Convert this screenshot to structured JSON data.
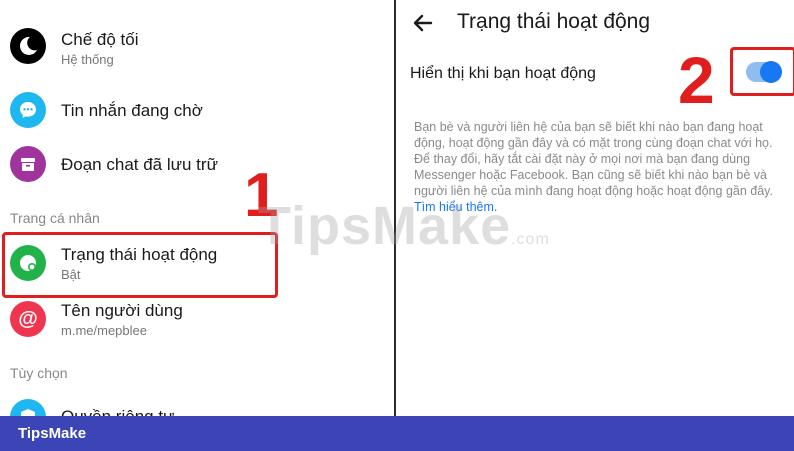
{
  "left": {
    "items": [
      {
        "title": "Chế độ tối",
        "subtitle": "Hệ thống",
        "icon": "moon-icon"
      },
      {
        "title": "Tin nhắn đang chờ",
        "icon": "chat-bubble-icon"
      },
      {
        "title": "Đoạn chat đã lưu trữ",
        "icon": "archive-icon"
      },
      {
        "title": "Trạng thái hoạt động",
        "subtitle": "Bật",
        "icon": "active-status-icon"
      },
      {
        "title": "Tên người dùng",
        "subtitle": "m.me/mepblee",
        "icon": "at-icon"
      },
      {
        "title": "Quyền riêng tư",
        "icon": "shield-icon"
      }
    ],
    "sections": {
      "personal": "Trang cá nhân",
      "options": "Tùy chọn"
    }
  },
  "right": {
    "title": "Trạng thái hoạt động",
    "toggle_label": "Hiển thị khi bạn hoạt động",
    "toggle_on": true,
    "description": "Bạn bè và người liên hệ của bạn sẽ biết khi nào bạn đang hoạt động, hoạt động gần đây và có mặt trong cùng đoạn chat với họ. Để thay đổi, hãy tắt cài đặt này ở mọi nơi mà bạn đang dùng Messenger hoặc Facebook. Bạn cũng sẽ biết khi nào bạn bè và người liên hệ của mình đang hoạt động hoặc hoạt động gần đây.",
    "link_text": "Tìm hiểu thêm."
  },
  "annotations": {
    "step1": "1",
    "step2": "2"
  },
  "watermark": {
    "main": "TipsMake",
    "suffix": ".com"
  },
  "footer": {
    "brand": "TipsMake"
  },
  "colors": {
    "accent": "#1877f2",
    "highlight": "#e01e1e",
    "footer_bg": "#3c45b5"
  }
}
